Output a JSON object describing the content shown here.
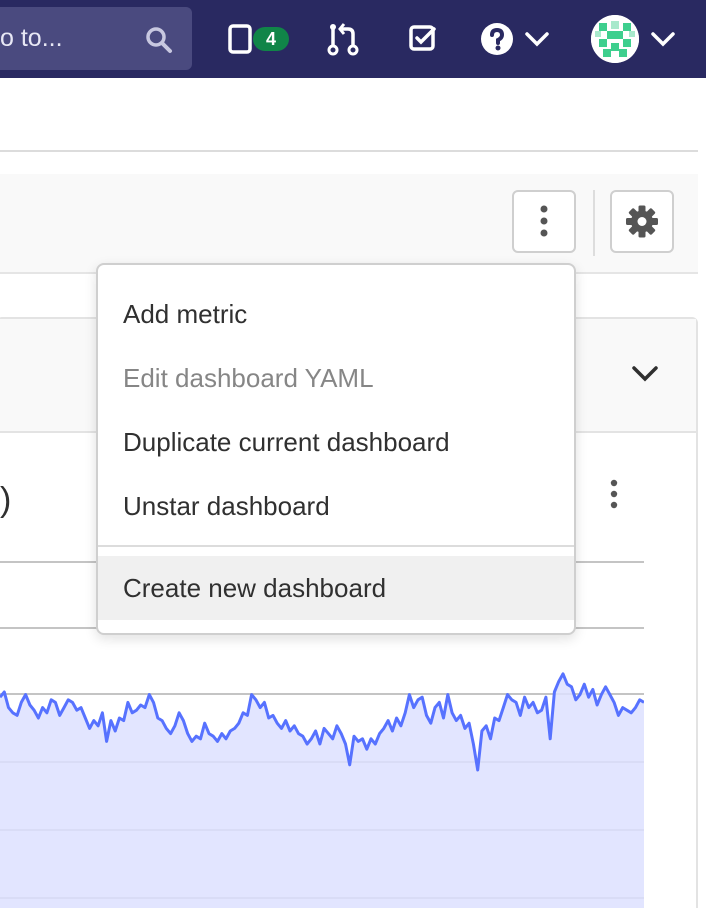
{
  "topnav": {
    "search_placeholder": "o to...",
    "todo_count": "4",
    "icons": [
      "search-icon",
      "issues-icon",
      "merge-requests-icon",
      "todos-icon",
      "help-icon",
      "chevron-down-icon",
      "avatar"
    ]
  },
  "dropdown": {
    "items": [
      {
        "label": "Add metric",
        "disabled": false
      },
      {
        "label": "Edit dashboard YAML",
        "disabled": true
      },
      {
        "label": "Duplicate current dashboard",
        "disabled": false
      },
      {
        "label": "Unstar dashboard",
        "disabled": false
      },
      {
        "label": "Create new dashboard",
        "disabled": false,
        "highlighted": true
      }
    ]
  },
  "panel": {
    "title_fragment": ")"
  },
  "colors": {
    "nav_bg": "#292961",
    "badge": "#108548",
    "line": "#5772ff",
    "area": "#dde0ff"
  },
  "chart_data": {
    "type": "area",
    "series": [
      {
        "values": [
          0.78,
          0.8,
          0.74,
          0.72,
          0.71,
          0.76,
          0.79,
          0.75,
          0.73,
          0.7,
          0.74,
          0.72,
          0.77,
          0.76,
          0.71,
          0.74,
          0.77,
          0.76,
          0.73,
          0.74,
          0.7,
          0.66,
          0.69,
          0.67,
          0.72,
          0.61,
          0.69,
          0.65,
          0.7,
          0.69,
          0.76,
          0.72,
          0.73,
          0.75,
          0.74,
          0.79,
          0.76,
          0.7,
          0.69,
          0.66,
          0.64,
          0.67,
          0.72,
          0.69,
          0.64,
          0.61,
          0.63,
          0.62,
          0.68,
          0.64,
          0.63,
          0.61,
          0.64,
          0.62,
          0.65,
          0.66,
          0.68,
          0.72,
          0.71,
          0.79,
          0.77,
          0.74,
          0.76,
          0.7,
          0.71,
          0.68,
          0.66,
          0.69,
          0.65,
          0.67,
          0.64,
          0.63,
          0.6,
          0.62,
          0.65,
          0.6,
          0.66,
          0.64,
          0.62,
          0.67,
          0.64,
          0.6,
          0.52,
          0.63,
          0.61,
          0.62,
          0.58,
          0.62,
          0.6,
          0.64,
          0.66,
          0.69,
          0.65,
          0.7,
          0.67,
          0.72,
          0.79,
          0.74,
          0.77,
          0.78,
          0.71,
          0.68,
          0.74,
          0.76,
          0.7,
          0.79,
          0.72,
          0.69,
          0.71,
          0.66,
          0.68,
          0.6,
          0.5,
          0.65,
          0.67,
          0.62,
          0.7,
          0.69,
          0.74,
          0.79,
          0.77,
          0.76,
          0.71,
          0.78,
          0.74,
          0.76,
          0.72,
          0.73,
          0.78,
          0.62,
          0.8,
          0.84,
          0.87,
          0.83,
          0.82,
          0.77,
          0.79,
          0.83,
          0.78,
          0.81,
          0.75,
          0.79,
          0.82,
          0.79,
          0.76,
          0.71,
          0.74,
          0.73,
          0.72,
          0.74,
          0.77,
          0.76
        ]
      }
    ]
  }
}
